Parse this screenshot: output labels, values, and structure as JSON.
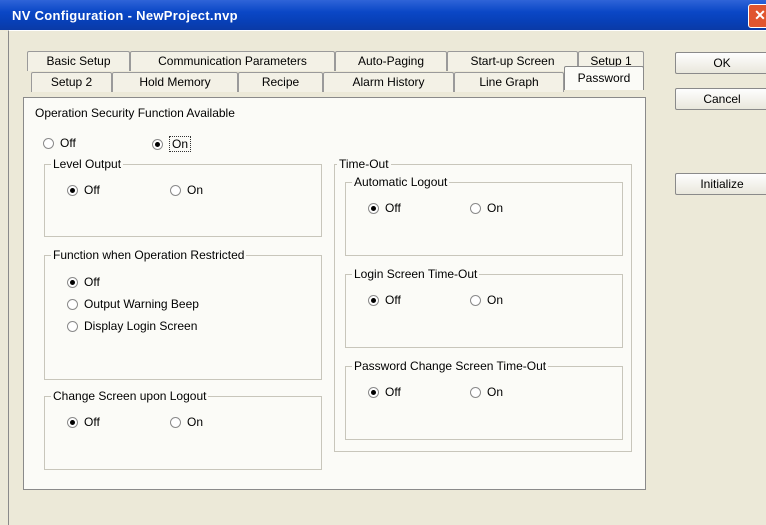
{
  "window": {
    "title": "NV Configuration - NewProject.nvp",
    "close_glyph": "✕"
  },
  "tabs_row1": [
    "Basic Setup",
    "Communication Parameters",
    "Auto-Paging",
    "Start-up Screen",
    "Setup 1"
  ],
  "tabs_row2": [
    "Setup 2",
    "Hold Memory",
    "Recipe",
    "Alarm History",
    "Line Graph",
    "Password"
  ],
  "active_tab": "Password",
  "buttons": {
    "ok": "OK",
    "cancel": "Cancel",
    "initialize": "Initialize"
  },
  "security": {
    "legend": "Operation Security Function Available",
    "off": "Off",
    "on": "On",
    "selected": "On"
  },
  "level_output": {
    "legend": "Level Output",
    "off": "Off",
    "on": "On",
    "selected": "Off"
  },
  "function_restricted": {
    "legend": "Function when Operation Restricted",
    "options": [
      "Off",
      "Output Warning Beep",
      "Display Login Screen"
    ],
    "selected": "Off"
  },
  "change_screen": {
    "legend": "Change Screen upon Logout",
    "off": "Off",
    "on": "On",
    "selected": "Off"
  },
  "timeout": {
    "legend": "Time-Out",
    "auto_logout": {
      "legend": "Automatic Logout",
      "off": "Off",
      "on": "On",
      "selected": "Off"
    },
    "login_screen": {
      "legend": "Login Screen Time-Out",
      "off": "Off",
      "on": "On",
      "selected": "Off"
    },
    "password_change": {
      "legend": "Password Change Screen Time-Out",
      "off": "Off",
      "on": "On",
      "selected": "Off"
    }
  }
}
